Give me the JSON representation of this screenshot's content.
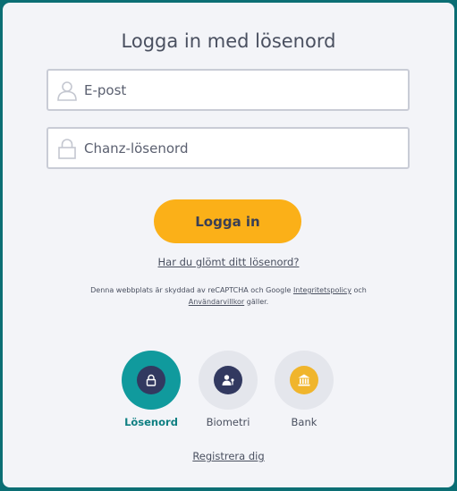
{
  "title": "Logga in med lösenord",
  "email_field": {
    "placeholder": "E-post",
    "icon": "user-icon"
  },
  "password_field": {
    "placeholder": "Chanz-lösenord",
    "icon": "lock-icon"
  },
  "login_button": "Logga in",
  "forgot_link": "Har du glömt ditt lösenord?",
  "recaptcha": {
    "text_before": "Denna webbplats är skyddad av reCAPTCHA och Google ",
    "privacy_link": "Integritetspolicy",
    "text_middle": " och ",
    "terms_link": "Användarvillkor",
    "text_after": " gäller."
  },
  "methods": [
    {
      "label": "Lösenord",
      "icon": "lock-icon",
      "active": true
    },
    {
      "label": "Biometri",
      "icon": "biometric-user-icon",
      "active": false
    },
    {
      "label": "Bank",
      "icon": "bank-icon",
      "active": false
    }
  ],
  "register_link": "Registrera dig",
  "colors": {
    "background": "#0b6e74",
    "card": "#f3f4f8",
    "accent": "#fbb018",
    "teal": "#109a9d",
    "navy": "#323960"
  }
}
